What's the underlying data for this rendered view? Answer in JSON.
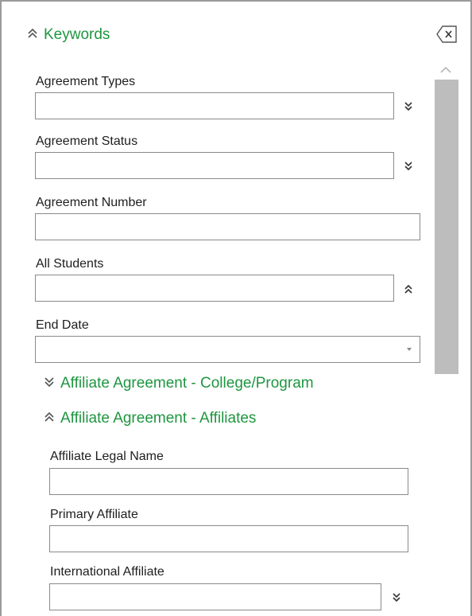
{
  "panel": {
    "keywords_title": "Keywords",
    "close_icon": "close-clear-icon"
  },
  "fields": {
    "agreement_types": {
      "label": "Agreement Types",
      "value": ""
    },
    "agreement_status": {
      "label": "Agreement Status",
      "value": ""
    },
    "agreement_number": {
      "label": "Agreement Number",
      "value": ""
    },
    "all_students": {
      "label": "All Students",
      "value": ""
    },
    "end_date": {
      "label": "End Date",
      "value": ""
    }
  },
  "sections": {
    "college_program": {
      "title": "Affiliate Agreement - College/Program",
      "state": "collapsed"
    },
    "affiliates": {
      "title": "Affiliate Agreement - Affiliates",
      "state": "expanded"
    }
  },
  "affiliate_fields": {
    "legal_name": {
      "label": "Affiliate Legal Name",
      "value": ""
    },
    "primary": {
      "label": "Primary Affiliate",
      "value": ""
    },
    "international": {
      "label": "International Affiliate",
      "value": ""
    }
  },
  "colors": {
    "accent_green": "#1e9640",
    "border": "#8a8a8a",
    "scrollbar_thumb": "#bdbdbd"
  }
}
